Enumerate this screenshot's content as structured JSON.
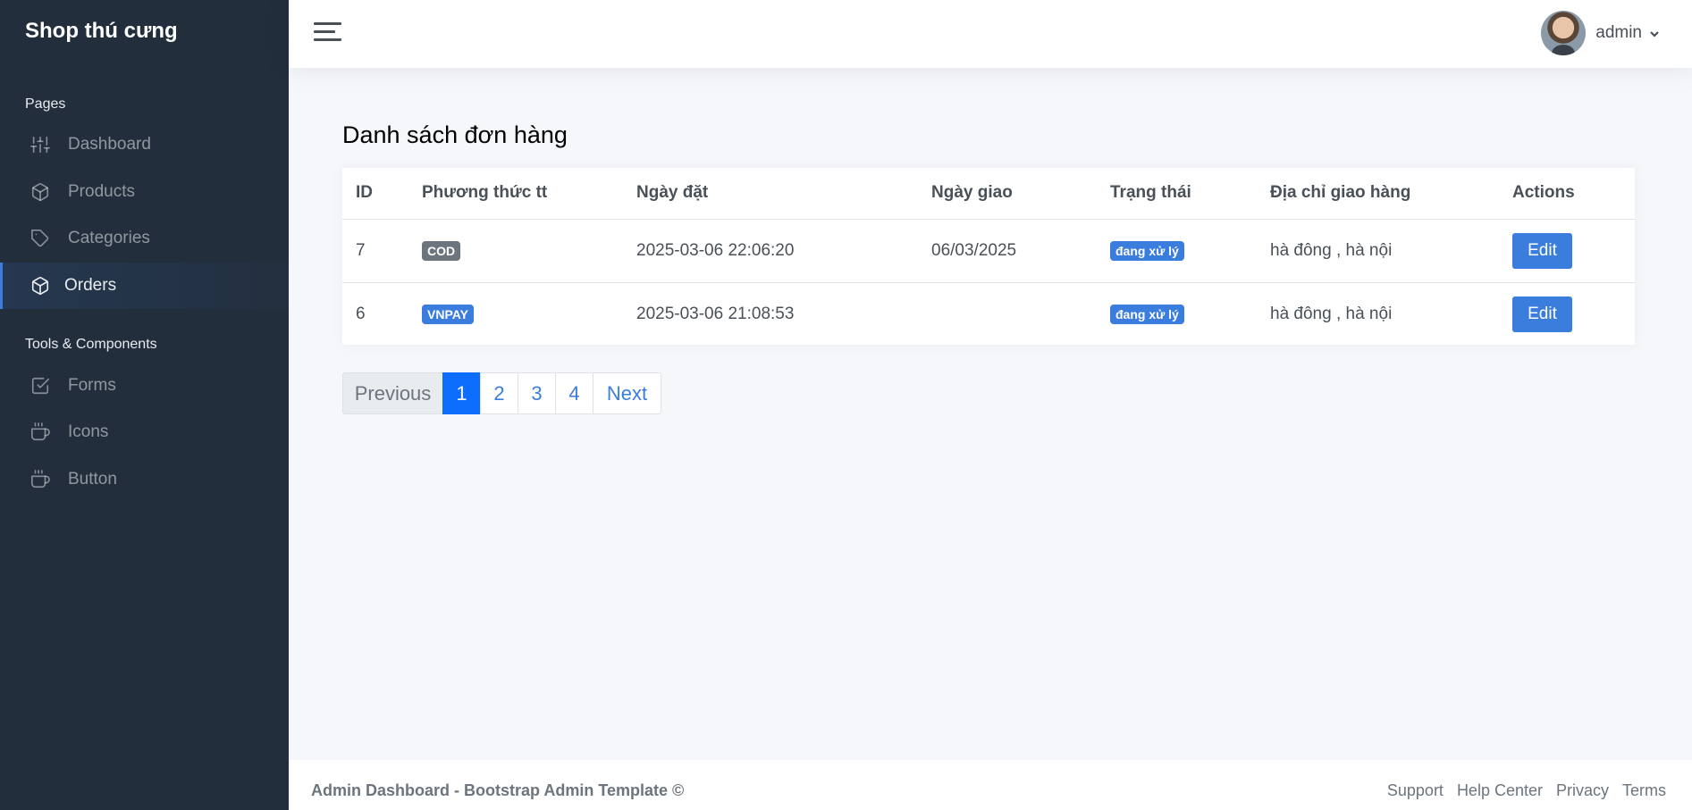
{
  "sidebar": {
    "brand": "Shop thú cưng",
    "sections": {
      "pages": "Pages",
      "tools": "Tools & Components"
    },
    "items": [
      {
        "label": "Dashboard",
        "icon": "sliders-icon"
      },
      {
        "label": "Products",
        "icon": "box-icon"
      },
      {
        "label": "Categories",
        "icon": "tag-icon"
      },
      {
        "label": "Orders",
        "icon": "box-icon",
        "active": true
      },
      {
        "label": "Forms",
        "icon": "check-square-icon"
      },
      {
        "label": "Icons",
        "icon": "coffee-icon"
      },
      {
        "label": "Button",
        "icon": "coffee-icon"
      }
    ]
  },
  "navbar": {
    "user_name": "admin"
  },
  "main": {
    "title": "Danh sách đơn hàng",
    "table": {
      "headers": [
        "ID",
        "Phương thức tt",
        "Ngày đặt",
        "Ngày giao",
        "Trạng thái",
        "Địa chỉ giao hàng",
        "Actions"
      ],
      "rows": [
        {
          "id": "7",
          "payment": "COD",
          "order_date": "2025-03-06 22:06:20",
          "delivery_date": "06/03/2025",
          "status": "đang xử lý",
          "address": "hà đông , hà nội",
          "action": "Edit"
        },
        {
          "id": "6",
          "payment": "VNPAY",
          "order_date": "2025-03-06 21:08:53",
          "delivery_date": "",
          "status": "đang xử lý",
          "address": "hà đông , hà nội",
          "action": "Edit"
        }
      ]
    },
    "pagination": {
      "previous": "Previous",
      "pages": [
        "1",
        "2",
        "3",
        "4"
      ],
      "current": "1",
      "next": "Next"
    }
  },
  "footer": {
    "text": "Admin Dashboard - Bootstrap Admin Template ©",
    "links": [
      "Support",
      "Help Center",
      "Privacy",
      "Terms"
    ]
  },
  "colors": {
    "sidebar_bg": "#222e3c",
    "primary": "#3b7ddd",
    "page_active": "#0d6efd",
    "badge_cod": "#6c757d",
    "content_bg": "#f5f7fb"
  }
}
